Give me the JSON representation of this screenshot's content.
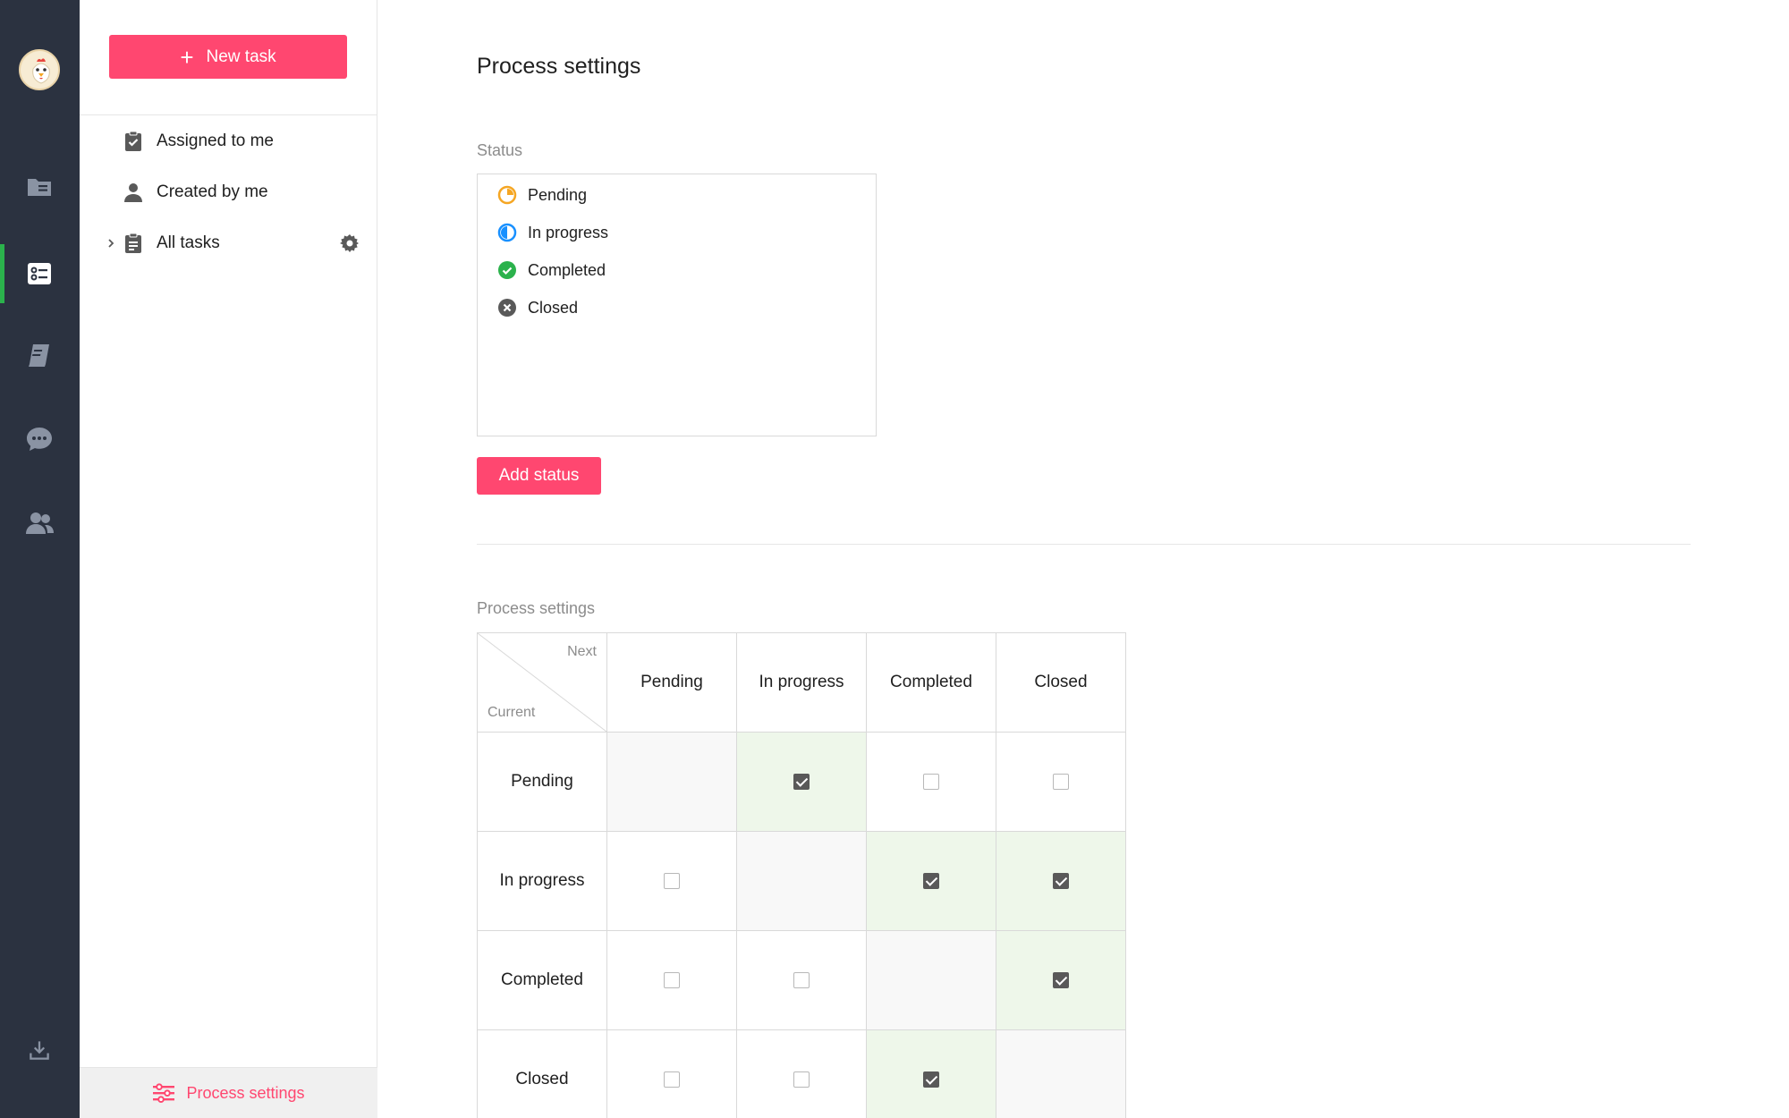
{
  "rail": {
    "items": [
      {
        "name": "files-icon"
      },
      {
        "name": "tasks-icon",
        "active": true
      },
      {
        "name": "notebook-icon"
      },
      {
        "name": "chat-icon"
      },
      {
        "name": "members-icon"
      },
      {
        "name": "download-icon"
      }
    ],
    "active_color": "#2bb24c"
  },
  "sidebar": {
    "new_task_label": "New task",
    "items": [
      {
        "label": "Assigned to me",
        "icon": "clipboard-check-icon"
      },
      {
        "label": "Created by me",
        "icon": "user-icon"
      },
      {
        "label": "All tasks",
        "icon": "clipboard-list-icon"
      }
    ],
    "footer_label": "Process settings"
  },
  "main": {
    "title": "Process settings",
    "status_section_label": "Status",
    "statuses": [
      {
        "label": "Pending",
        "icon": "pending-icon",
        "color": "#f5a623"
      },
      {
        "label": "In progress",
        "icon": "in-progress-icon",
        "color": "#1890ff"
      },
      {
        "label": "Completed",
        "icon": "completed-icon",
        "color": "#2bb24c"
      },
      {
        "label": "Closed",
        "icon": "closed-icon",
        "color": "#595959"
      }
    ],
    "add_status_label": "Add status",
    "process_section_label": "Process settings",
    "matrix": {
      "next_label": "Next",
      "current_label": "Current",
      "columns": [
        "Pending",
        "In progress",
        "Completed",
        "Closed"
      ],
      "rows": [
        {
          "label": "Pending",
          "cells": [
            null,
            true,
            false,
            false
          ]
        },
        {
          "label": "In progress",
          "cells": [
            false,
            null,
            true,
            true
          ]
        },
        {
          "label": "Completed",
          "cells": [
            false,
            false,
            null,
            true
          ]
        },
        {
          "label": "Closed",
          "cells": [
            false,
            false,
            true,
            null
          ]
        }
      ]
    }
  },
  "colors": {
    "accent": "#ff4770",
    "rail_bg": "#2b3240",
    "checked_bg": "#eef7ea"
  }
}
